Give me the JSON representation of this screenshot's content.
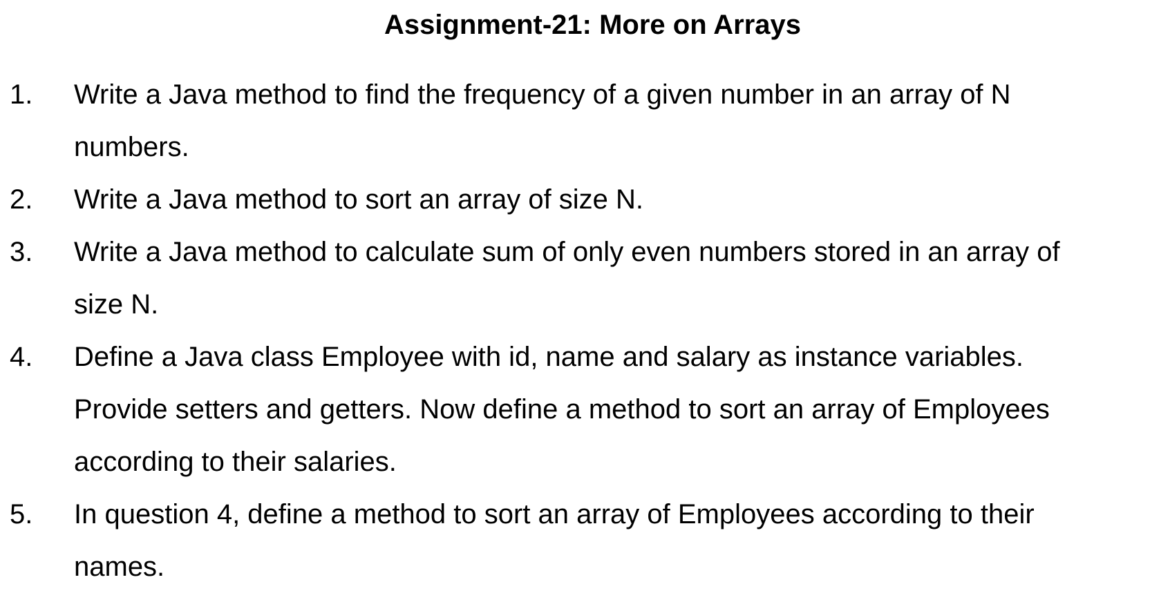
{
  "title": "Assignment-21: More on Arrays",
  "questions": [
    {
      "number": "1.",
      "lines": [
        "Write a Java method to find the frequency of a given number in an array of N",
        "numbers."
      ]
    },
    {
      "number": "2.",
      "lines": [
        "Write a Java method to sort an array of size N."
      ]
    },
    {
      "number": "3.",
      "lines": [
        "Write a Java method to calculate sum of only even numbers stored in an array of",
        "size N."
      ]
    },
    {
      "number": "4.",
      "lines": [
        "Define a Java class Employee with id, name and salary as instance variables.",
        "Provide setters and getters. Now define a method to sort an array of Employees",
        "according to their salaries."
      ]
    },
    {
      "number": "5.",
      "lines": [
        "In question 4, define a method to sort an array of Employees according to their",
        "names."
      ]
    }
  ]
}
